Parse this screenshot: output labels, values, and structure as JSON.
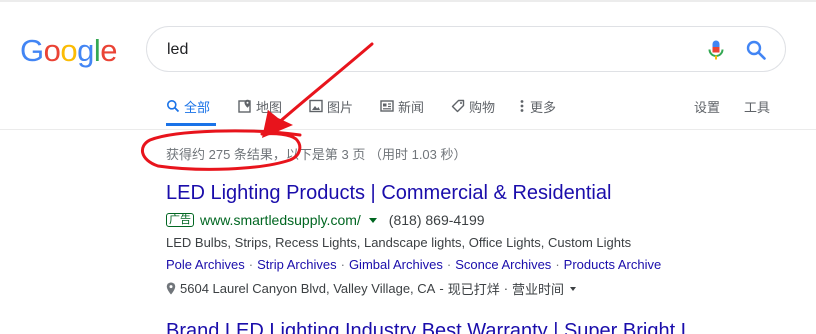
{
  "logo": {
    "letters": [
      "G",
      "o",
      "o",
      "g",
      "l",
      "e"
    ],
    "colors": [
      "#4285F4",
      "#EA4335",
      "#FBBC05",
      "#4285F4",
      "#34A853",
      "#EA4335"
    ]
  },
  "search": {
    "query": "led"
  },
  "tabs": [
    {
      "label": "全部",
      "icon": "search-icon",
      "active": true
    },
    {
      "label": "地图",
      "icon": "map-icon"
    },
    {
      "label": "图片",
      "icon": "image-icon"
    },
    {
      "label": "新闻",
      "icon": "news-icon"
    },
    {
      "label": "购物",
      "icon": "tag-icon"
    },
    {
      "label": "更多",
      "icon": "more-dots-icon"
    }
  ],
  "tools": {
    "settings": "设置",
    "tools": "工具"
  },
  "result_stats": "获得约 275 条结果，以下是第 3 页 （用时 1.03 秒）",
  "ad": {
    "title": "LED Lighting Products | Commercial & Residential",
    "badge": "广告",
    "url": "www.smartledsupply.com/",
    "phone": "(818) 869-4199",
    "description": "LED Bulbs, Strips, Recess Lights, Landscape lights, Office Lights, Custom Lights",
    "sitelinks": [
      "Pole Archives",
      "Strip Archives",
      "Gimbal Archives",
      "Sconce Archives",
      "Products Archive"
    ],
    "sitelink_separator": "·",
    "location": {
      "address": "5604 Laurel Canyon Blvd, Valley Village, CA",
      "status": "现已打烊",
      "hours": "营业时间"
    }
  },
  "next_result_title": "Brand LED Lighting Industry Best Warranty | Super Bright LED",
  "colors": {
    "accent": "#1a73e8",
    "link": "#1a0dab",
    "ad_green": "#006621",
    "annotation_red": "#e8141c"
  }
}
